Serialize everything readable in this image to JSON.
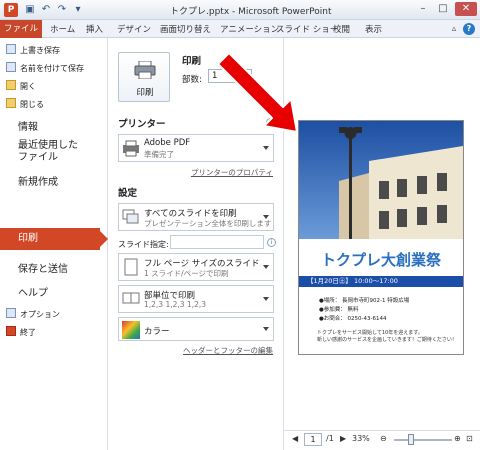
{
  "titlebar": {
    "app_icon": "P",
    "title": "トクプレ.pptx  -  Microsoft PowerPoint",
    "qat_icons": [
      "save-icon",
      "undo-icon",
      "redo-icon",
      "customize-icon"
    ],
    "controls": {
      "minimize": "–",
      "maximize": "□",
      "close": "✕"
    }
  },
  "ribbon": {
    "tabs": [
      "ファイル",
      "ホーム",
      "挿入",
      "デザイン",
      "画面切り替え",
      "アニメーション",
      "スライド ショー",
      "校閲",
      "表示"
    ],
    "help_glyphs": {
      "collapse": "▵",
      "help": "?"
    }
  },
  "sidebar": {
    "small_items": [
      "上書き保存",
      "名前を付けて保存",
      "開く",
      "閉じる"
    ],
    "big_items": [
      "情報",
      "最近使用した\nファイル",
      "新規作成",
      "印刷",
      "保存と送信",
      "ヘルプ"
    ],
    "footer_items": [
      "オプション",
      "終了"
    ],
    "selected": "印刷"
  },
  "print": {
    "button_label": "印刷",
    "title": "印刷",
    "copies_label": "部数:",
    "copies_value": "1"
  },
  "printer": {
    "heading": "プリンター",
    "name": "Adobe PDF",
    "status": "準備完了",
    "properties_link": "プリンターのプロパティ"
  },
  "settings": {
    "heading": "設定",
    "slides_dropdown": {
      "line1": "すべてのスライドを印刷",
      "line2": "プレゼンテーション全体を印刷します"
    },
    "slide_spec_label": "スライド指定:",
    "slide_spec_value": "",
    "layout_dropdown": {
      "line1": "フル ページ サイズのスライド",
      "line2": "1 スライド/ページで印刷"
    },
    "collate_dropdown": {
      "line1": "部単位で印刷",
      "line2": "1,2,3    1,2,3    1,2,3"
    },
    "color_dropdown": {
      "line1": "カラー"
    },
    "header_footer_link": "ヘッダーとフッターの編集",
    "info_glyph": "i"
  },
  "preview": {
    "slide_title": "トクプレ大創業祭",
    "bar_text": "【1月20日㊏】  10:00〜17:00",
    "lines": [
      "●場所：   長岡市寺町902-1  特設広場",
      "●参加費：  無料",
      "●お問合：  0250-43-6144"
    ],
    "small_lines": [
      "トクプレをサービス開始して10年を迎えます。",
      "新しい感謝のサービスを企画していきます！ご期待ください！"
    ]
  },
  "navbar": {
    "prev": "◀",
    "page": "1",
    "page_total": "/1",
    "next": "▶",
    "zoom": "33%",
    "zoom_minus": "⊖",
    "zoom_plus": "⊕",
    "fit_glyph": "⊡"
  },
  "colors": {
    "accent": "#d24726",
    "arrow": "#e60000",
    "slide_blue": "#1a4ea8"
  }
}
